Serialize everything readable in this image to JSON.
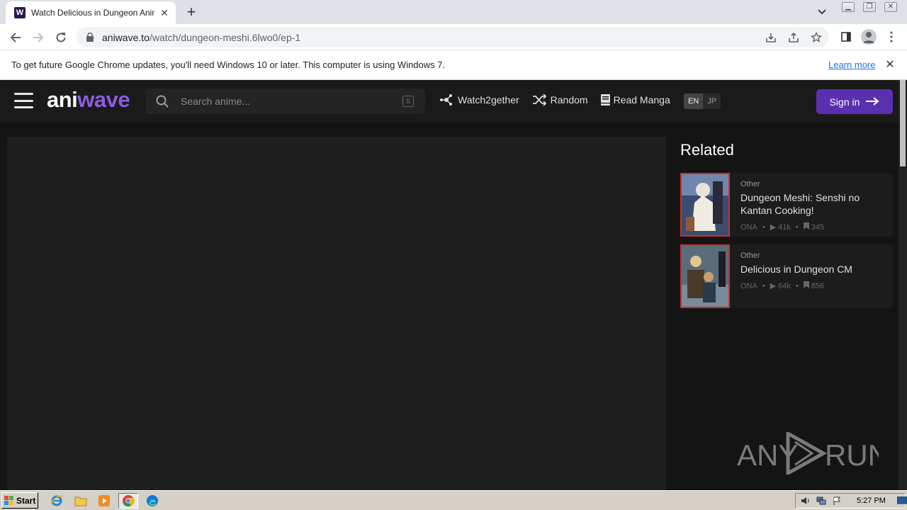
{
  "browser": {
    "tab_title": "Watch Delicious in Dungeon Anime O",
    "tab_favicon_letter": "W",
    "url_domain": "aniwave.to",
    "url_path": "/watch/dungeon-meshi.6lwo0/ep-1"
  },
  "infobar": {
    "message": "To get future Google Chrome updates, you'll need Windows 10 or later. This computer is using Windows 7.",
    "link": "Learn more"
  },
  "site": {
    "logo_part1": "ani",
    "logo_part2": "wave",
    "search_placeholder": "Search anime...",
    "search_shortcut": "S",
    "nav": [
      "Watch2gether",
      "Random",
      "Read Manga"
    ],
    "languages": [
      "EN",
      "JP"
    ],
    "active_language": "EN",
    "signin": "Sign in",
    "accent_color": "#5a2fb0"
  },
  "related": {
    "title": "Related",
    "items": [
      {
        "type": "Other",
        "name": "Dungeon Meshi: Senshi no Kantan Cooking!",
        "format": "ONA",
        "views": "41k",
        "bookmarks": "345"
      },
      {
        "type": "Other",
        "name": "Delicious in Dungeon CM",
        "format": "ONA",
        "views": "64k",
        "bookmarks": "856"
      }
    ]
  },
  "watermark": {
    "text_left": "ANY",
    "text_right": "RUN"
  },
  "taskbar": {
    "start": "Start",
    "clock": "5:27 PM"
  }
}
